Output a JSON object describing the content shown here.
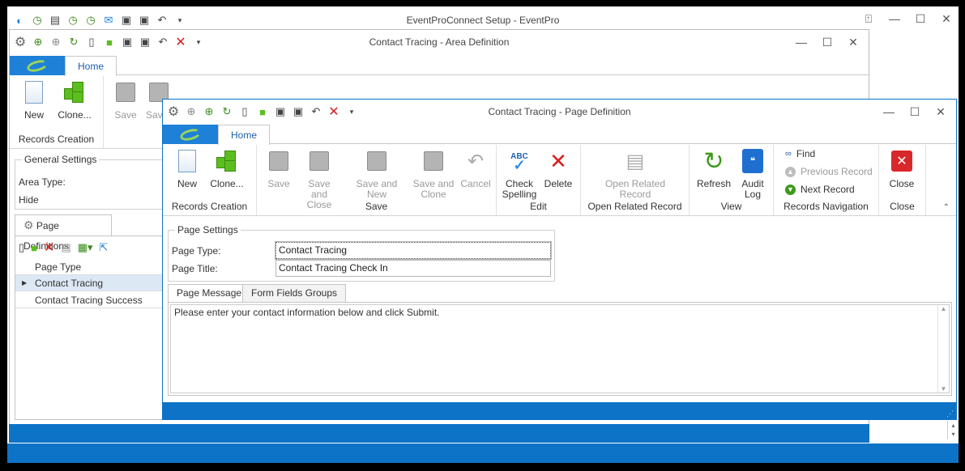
{
  "main": {
    "title": "EventProConnect Setup - EventPro"
  },
  "area": {
    "title": "Contact Tracing - Area Definition",
    "home_tab": "Home",
    "btn_new": "New",
    "btn_clone": "Clone...",
    "btn_save": "Save",
    "btn_save_close": "Sav",
    "group_records": "Records Creation",
    "general_settings": "General Settings",
    "area_type_label": "Area Type:",
    "hide_label": "Hide",
    "page_definitions_tab": "Page Definitions",
    "col_page_type": "Page Type",
    "rows": [
      "Contact Tracing",
      "Contact Tracing Success"
    ]
  },
  "page": {
    "title": "Contact Tracing - Page Definition",
    "home_tab": "Home",
    "btn_new": "New",
    "btn_clone": "Clone...",
    "btn_save": "Save",
    "btn_save_close": "Save and Close",
    "btn_save_new": "Save and New",
    "btn_save_clone": "Save and Clone",
    "btn_cancel": "Cancel",
    "btn_check": "Check Spelling",
    "btn_delete": "Delete",
    "btn_open_related": "Open Related Record",
    "btn_refresh": "Refresh",
    "btn_audit": "Audit Log",
    "nav_find": "Find",
    "nav_prev": "Previous Record",
    "nav_next": "Next Record",
    "btn_close": "Close",
    "group_records": "Records Creation",
    "group_save": "Save",
    "group_edit": "Edit",
    "group_open": "Open Related Record",
    "group_view": "View",
    "group_nav": "Records Navigation",
    "group_close": "Close",
    "page_settings": "Page Settings",
    "page_type_label": "Page Type:",
    "page_type_value": "Contact Tracing",
    "page_title_label": "Page Title:",
    "page_title_value": "Contact Tracing Check In",
    "tab_message": "Page Message",
    "tab_fields": "Form Fields Groups",
    "message": "Please enter your contact information below and click Submit."
  }
}
